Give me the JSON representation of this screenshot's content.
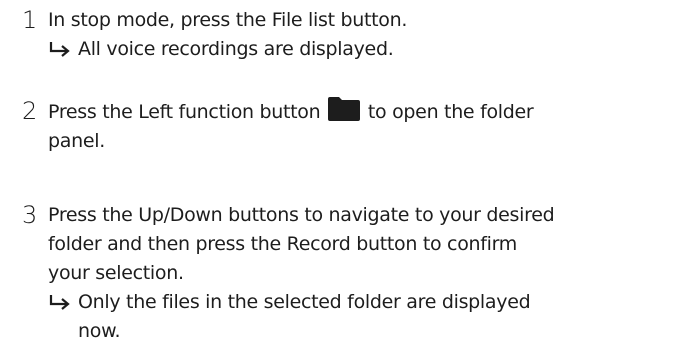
{
  "steps": [
    {
      "number": "1",
      "lines": [
        "In stop mode, press the File list button."
      ],
      "result_lines": [
        "All voice recordings are displayed."
      ]
    },
    {
      "number": "2",
      "line1_before_icon": "Press the Left function button",
      "line1_after_icon": "to open the folder",
      "line2": "panel.",
      "icon": "folder-icon"
    },
    {
      "number": "3",
      "lines": [
        "Press the Up/Down buttons to navigate to your desired",
        "folder and then press the Record button to confirm",
        "your selection."
      ],
      "result_lines": [
        "Only the files in the selected folder are displayed",
        "now."
      ]
    }
  ],
  "colors": {
    "text": "#1d1d1d",
    "icon": "#1d1d1d"
  }
}
